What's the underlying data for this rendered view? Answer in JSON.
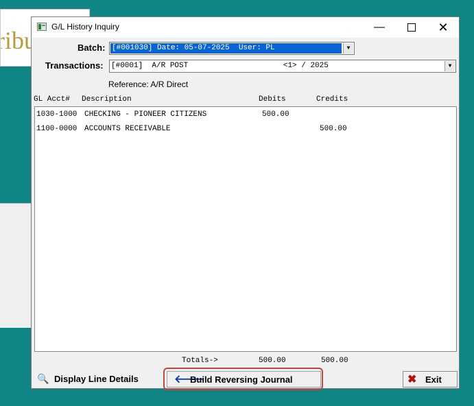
{
  "background_app": {
    "partial_title": "ribu"
  },
  "window": {
    "title": "G/L History Inquiry",
    "minimize_symbol": "—",
    "close_symbol": "✕"
  },
  "batch": {
    "label": "Batch:",
    "value": "[#001030] Date: 05-07-2025  User: PL"
  },
  "transactions": {
    "label": "Transactions:",
    "value": "[#0001]  A/R POST                     <1> / 2025"
  },
  "reference": "Reference: A/R Direct",
  "columns": {
    "acct": "GL Acct#",
    "description": "Description",
    "debits": "Debits",
    "credits": "Credits"
  },
  "rows": [
    {
      "acct": "1030-1000",
      "description": "CHECKING - PIONEER CITIZENS",
      "debit": "500.00",
      "credit": ""
    },
    {
      "acct": "1100-0000",
      "description": "ACCOUNTS RECEIVABLE",
      "debit": "",
      "credit": "500.00"
    }
  ],
  "totals": {
    "label": "Totals->",
    "debits": "500.00",
    "credits": "500.00"
  },
  "buttons": {
    "display_line_details": "Display Line Details",
    "build_reversing_journal": "Build Reversing Journal",
    "exit": "Exit"
  },
  "icons": {
    "details": "magnifier-icon",
    "reverse": "arrow-left-icon",
    "exit": "red-x-icon"
  },
  "colors": {
    "desktop": "#0f8585",
    "selection": "#0a64d4",
    "highlight_outline": "#c0483c"
  }
}
